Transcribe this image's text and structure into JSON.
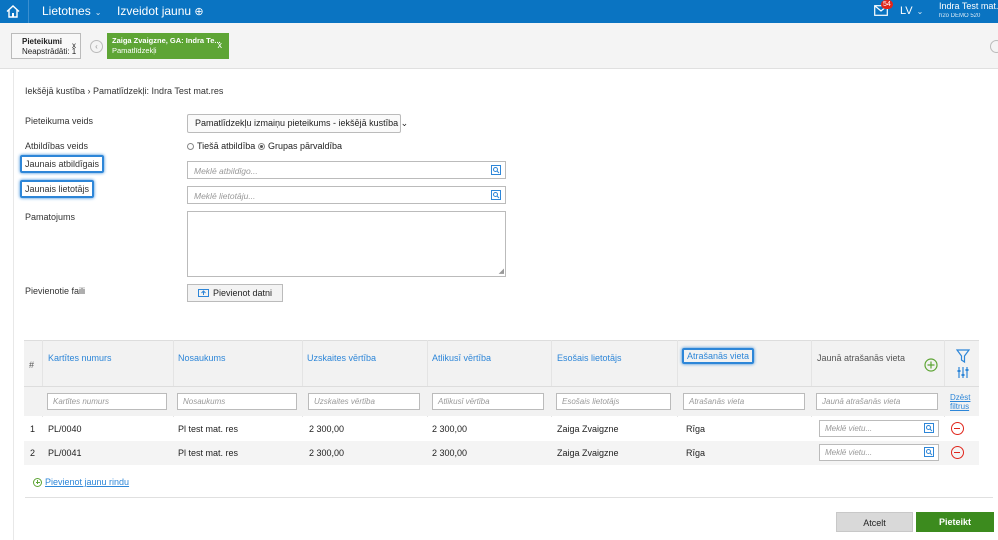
{
  "topbar": {
    "home_icon": "home-icon",
    "menu1": "Lietotnes",
    "menu2": "Izveidot jaunu",
    "notif_count": "54",
    "lang": "LV",
    "user_name": "Indra Test mat.",
    "user_sub": "h2o DEMO 520",
    "colors": {
      "bar": "#0a74c2",
      "badge": "#e0261c"
    }
  },
  "tabs": [
    {
      "line1": "Pieteikumi",
      "line2": "Neapstrādāti: 1",
      "close": "x"
    },
    {
      "line1": "Zaiga Zvaigzne, GA: Indra Te...",
      "line2": "Pamatlīdzekļi",
      "close": "x",
      "color": "#5ea535"
    }
  ],
  "breadcrumb": "Iekšējā kustība › Pamatlīdzekļi: Indra Test mat.res",
  "form": {
    "request_type_label": "Pieteikuma veids",
    "request_type_value": "Pamatlīdzekļu izmaiņu pieteikums - iekšējā kustība",
    "responsibility_label": "Atbildības veids",
    "radio_direct": "Tiešā atbildība",
    "radio_group": "Grupas pārvaldība",
    "new_responsible_label": "Jaunais atbildīgais",
    "new_responsible_placeholder": "Meklē atbildīgo...",
    "new_user_label": "Jaunais lietotājs",
    "new_user_placeholder": "Meklē lietotāju...",
    "justification_label": "Pamatojums",
    "attachments_label": "Pievienotie faili",
    "add_file_button": "Pievienot datni"
  },
  "table": {
    "hash": "#",
    "columns": [
      "Kartītes numurs",
      "Nosaukums",
      "Uzskaites vērtība",
      "Atlikusī vērtība",
      "Esošais lietotājs",
      "Atrašanās vieta",
      "Jaunā atrašanās vieta"
    ],
    "filters": [
      "Kartītes numurs",
      "Nosaukums",
      "Uzskaites vērtība",
      "Atlikusī vērtība",
      "Esošais lietotājs",
      "Atrašanās vieta",
      "Jaunā atrašanās vieta"
    ],
    "clear_filters": "Dzēst filtrus",
    "rows": [
      {
        "n": "1",
        "card": "PL/0040",
        "name": "Pl test mat. res",
        "book": "2 300,00",
        "rest": "2 300,00",
        "user": "Zaiga Zvaigzne",
        "loc": "Rīga",
        "new_loc_placeholder": "Meklē vietu..."
      },
      {
        "n": "2",
        "card": "PL/0041",
        "name": "Pl test mat. res",
        "book": "2 300,00",
        "rest": "2 300,00",
        "user": "Zaiga Zvaigzne",
        "loc": "Rīga",
        "new_loc_placeholder": "Meklē vietu..."
      }
    ],
    "add_row": "Pievienot jaunu rindu"
  },
  "footer": {
    "cancel": "Atcelt",
    "submit": "Pieteikt",
    "submit_color": "#3c8b1e"
  }
}
